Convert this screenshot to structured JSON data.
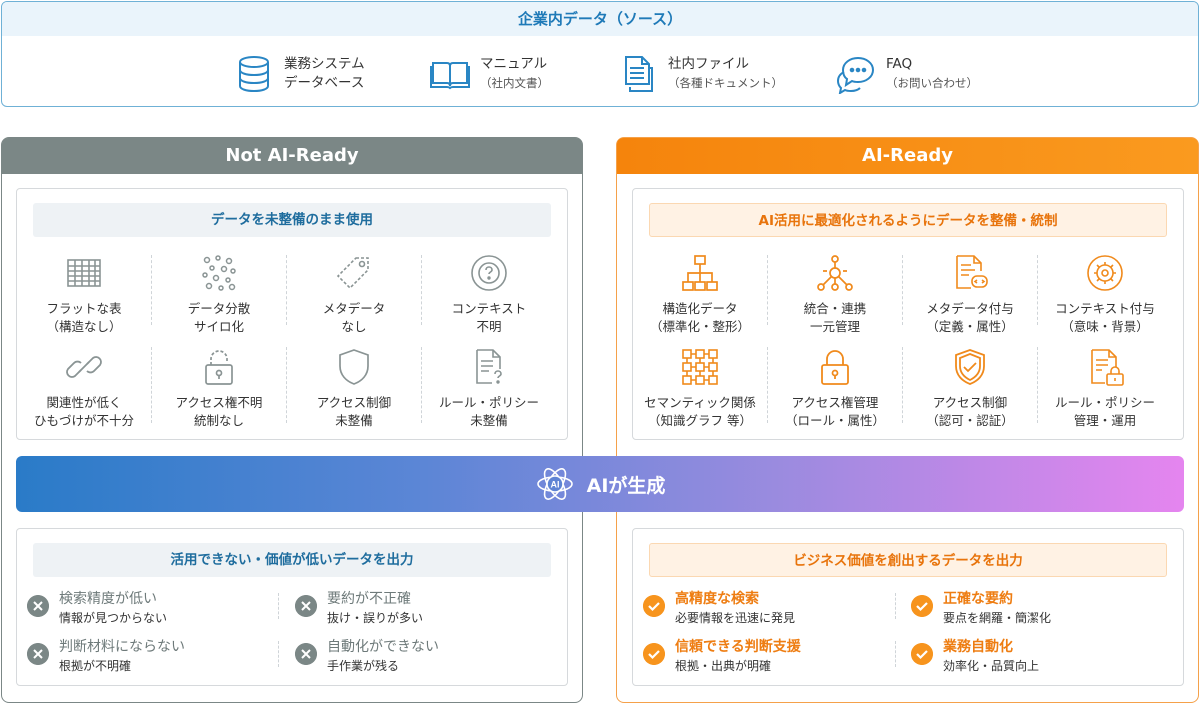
{
  "sources": {
    "title": "企業内データ（ソース）",
    "items": [
      {
        "icon": "database-icon",
        "line1": "業務システム",
        "line2": "データベース"
      },
      {
        "icon": "manual-book-icon",
        "line1": "マニュアル",
        "line2": "（社内文書）"
      },
      {
        "icon": "documents-icon",
        "line1": "社内ファイル",
        "line2": "（各種ドキュメント）"
      },
      {
        "icon": "faq-chat-icon",
        "line1": "FAQ",
        "line2": "（お問い合わせ）"
      }
    ]
  },
  "not_ready": {
    "header": "Not AI-Ready",
    "input_title": "データを未整備のまま使用",
    "items": [
      {
        "icon": "flat-table-icon",
        "line1": "フラットな表",
        "line2": "（構造なし）"
      },
      {
        "icon": "scattered-dots-icon",
        "line1": "データ分散",
        "line2": "サイロ化"
      },
      {
        "icon": "tag-icon",
        "line1": "メタデータ",
        "line2": "なし"
      },
      {
        "icon": "question-cycle-icon",
        "line1": "コンテキスト",
        "line2": "不明"
      },
      {
        "icon": "broken-link-icon",
        "line1": "関連性が低く",
        "line2": "ひもづけが不十分"
      },
      {
        "icon": "open-lock-icon",
        "line1": "アクセス権不明",
        "line2": "統制なし"
      },
      {
        "icon": "shield-icon",
        "line1": "アクセス制御",
        "line2": "未整備"
      },
      {
        "icon": "doc-question-icon",
        "line1": "ルール・ポリシー",
        "line2": "未整備"
      }
    ],
    "output_title": "活用できない・価値が低いデータを出力",
    "outputs": [
      {
        "title": "検索精度が低い",
        "desc": "情報が見つからない"
      },
      {
        "title": "要約が不正確",
        "desc": "抜け・誤りが多い"
      },
      {
        "title": "判断材料にならない",
        "desc": "根拠が不明確"
      },
      {
        "title": "自動化ができない",
        "desc": "手作業が残る"
      }
    ]
  },
  "ready": {
    "header": "AI-Ready",
    "input_title": "AI活用に最適化されるようにデータを整備・統制",
    "items": [
      {
        "icon": "hierarchy-icon",
        "line1": "構造化データ",
        "line2": "（標準化・整形）"
      },
      {
        "icon": "integration-icon",
        "line1": "統合・連携",
        "line2": "一元管理"
      },
      {
        "icon": "metadata-doc-icon",
        "line1": "メタデータ付与",
        "line2": "（定義・属性）"
      },
      {
        "icon": "gear-cycle-icon",
        "line1": "コンテキスト付与",
        "line2": "（意味・背景）"
      },
      {
        "icon": "knowledge-graph-icon",
        "line1": "セマンティック関係",
        "line2": "（知識グラフ 等）"
      },
      {
        "icon": "lock-icon",
        "line1": "アクセス権管理",
        "line2": "（ロール・属性）"
      },
      {
        "icon": "shield-check-icon",
        "line1": "アクセス制御",
        "line2": "（認可・認証）"
      },
      {
        "icon": "doc-lock-icon",
        "line1": "ルール・ポリシー",
        "line2": "管理・運用"
      }
    ],
    "output_title": "ビジネス価値を創出するデータを出力",
    "outputs": [
      {
        "title": "高精度な検索",
        "desc": "必要情報を迅速に発見"
      },
      {
        "title": "正確な要約",
        "desc": "要点を網羅・簡潔化"
      },
      {
        "title": "信頼できる判断支援",
        "desc": "根拠・出典が明確"
      },
      {
        "title": "業務自動化",
        "desc": "効率化・品質向上"
      }
    ]
  },
  "ai_band": {
    "icon": "ai-atom-icon",
    "label": "AIが生成"
  },
  "colors": {
    "blue": "#1f7ab8",
    "grey": "#7b8786",
    "orange": "#f7941d"
  }
}
